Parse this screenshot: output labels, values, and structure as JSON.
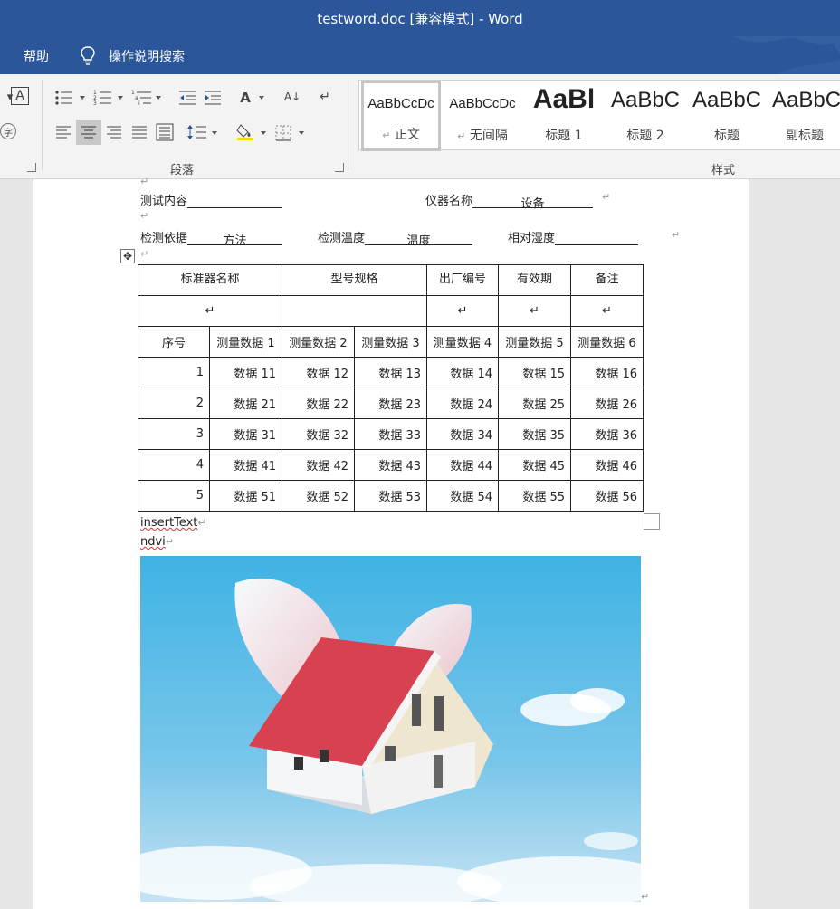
{
  "window": {
    "title": "testword.doc [兼容模式]  -  Word"
  },
  "menu": {
    "help": "帮助",
    "tell_me": "操作说明搜索"
  },
  "ribbon": {
    "paragraph_group": "段落",
    "styles_group": "样式",
    "styles": [
      {
        "sample": "AaBbCcDc",
        "name": "正文",
        "mark": "↵"
      },
      {
        "sample": "AaBbCcDc",
        "name": "无间隔",
        "mark": "↵"
      },
      {
        "sample": "AaBl",
        "name": "标题 1"
      },
      {
        "sample": "AaBbC",
        "name": "标题 2"
      },
      {
        "sample": "AaBbC",
        "name": "标题"
      },
      {
        "sample": "AaBbC",
        "name": "副标题"
      }
    ]
  },
  "document": {
    "test_content_label": "测试内容",
    "instrument_label": "仪器名称",
    "instrument_value": "设备",
    "basis_label": "检测依据",
    "basis_value": "方法",
    "temp_label": "检测温度",
    "temp_value": "温度",
    "humidity_label": "相对湿度",
    "para_mark": "↵",
    "table": {
      "header": [
        "标准器名称",
        "型号规格",
        "出厂编号",
        "有效期",
        "备注"
      ],
      "subheader": [
        "序号",
        "测量数据 1",
        "测量数据 2",
        "测量数据 3",
        "测量数据 4",
        "测量数据 5",
        "测量数据 6"
      ],
      "rows": [
        [
          "1",
          "数据 11",
          "数据 12",
          "数据 13",
          "数据 14",
          "数据 15",
          "数据 16"
        ],
        [
          "2",
          "数据 21",
          "数据 22",
          "数据 23",
          "数据 24",
          "数据 25",
          "数据 26"
        ],
        [
          "3",
          "数据 31",
          "数据 32",
          "数据 33",
          "数据 34",
          "数据 35",
          "数据 36"
        ],
        [
          "4",
          "数据 41",
          "数据 42",
          "数据 43",
          "数据 44",
          "数据 45",
          "数据 46"
        ],
        [
          "5",
          "数据 51",
          "数据 52",
          "数据 53",
          "数据 54",
          "数据 55",
          "数据 56"
        ]
      ]
    },
    "insert_text": "insertText",
    "ndvi_text": "ndvi"
  }
}
